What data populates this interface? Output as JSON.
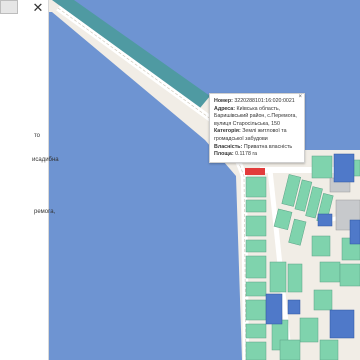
{
  "sidebar": {
    "close_icon": "close-icon",
    "fragments": [
      "то",
      "исадибна",
      "ремога,"
    ]
  },
  "map": {
    "colors": {
      "water": "#6e94d2",
      "land": "#f1ede6",
      "road": "#f6f4ee",
      "channel": "#4f9aa2",
      "parcel_green": "#7fd3ad",
      "parcel_blue": "#4f79c9",
      "parcel_red": "#e23b3b"
    }
  },
  "popup": {
    "number_label": "Номер:",
    "number_value": "3220288101:16:020:0021",
    "address_label": "Адреса:",
    "address_value": "Київська область, Баришівський район, с.Перемога, вулиця Старосільська, 150",
    "category_label": "Категорія:",
    "category_value": "Землі житлової та громадської забудови",
    "ownership_label": "Власність:",
    "ownership_value": "Приватна власність",
    "area_label": "Площа:",
    "area_value": "0.1178 га"
  }
}
